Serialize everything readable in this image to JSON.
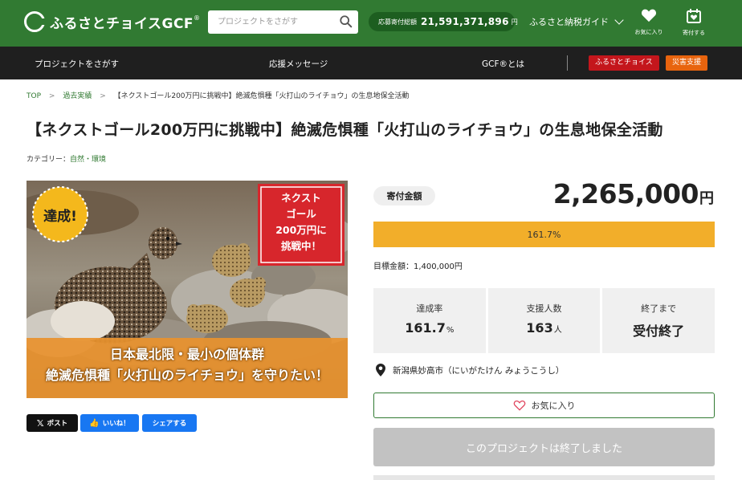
{
  "header": {
    "logo_text": "ふるさとチョイスGCF",
    "logo_reg": "®",
    "search_placeholder": "プロジェクトをさがす",
    "total_label": "応募寄付総額",
    "total_value": "21,591,371,896",
    "total_unit": "円",
    "guide_label": "ふるさと納税ガイド",
    "favorites_label": "お気に入り",
    "donate_label": "寄付する"
  },
  "nav": {
    "find": "プロジェクトをさがす",
    "messages": "応援メッセージ",
    "about": "GCF®とは",
    "choice_badge": "ふるさとチョイス",
    "disaster_badge": "災害支援",
    "choice_color": "#c4161c",
    "disaster_color": "#e8640e"
  },
  "breadcrumb": {
    "top": "TOP",
    "past": "過去実績",
    "current": "【ネクストゴール200万円に挑戦中】絶滅危惧種「火打山のライチョウ」の生息地保全活動"
  },
  "project": {
    "title": "【ネクストゴール200万円に挑戦中】絶滅危惧種「火打山のライチョウ」の生息地保全活動",
    "category_label": "カテゴリー：",
    "category_value": "自然・環境"
  },
  "hero": {
    "badge": "達成!",
    "goal_line1": "ネクスト",
    "goal_line2": "ゴール",
    "goal_line3": "200万円に",
    "goal_line4": "挑戦中！",
    "caption_line1": "日本最北限・最小の個体群",
    "caption_line2": "絶滅危惧種「火打山のライチョウ」を守りたい！"
  },
  "share": {
    "post": "ポスト",
    "like": "いいね！",
    "share": "シェアする"
  },
  "funding": {
    "amount_label": "寄付金額",
    "amount": "2,265,000",
    "amount_unit": "円",
    "progress_text": "161.7%",
    "progress_fraction": 1.0,
    "target": "目標金額：1,400,000円",
    "stats": {
      "rate_label": "達成率",
      "rate_value": "161.7",
      "rate_unit": "%",
      "supporters_label": "支援人数",
      "supporters_value": "163",
      "supporters_unit": "人",
      "end_label": "終了まで",
      "end_value": "受付終了"
    },
    "location": "新潟県妙高市（にいがたけん みょうこうし）",
    "favorite_button": "お気に入り",
    "ended_button": "このプロジェクトは終了しました"
  },
  "colors": {
    "brand_green": "#317a32",
    "progress": "#f2ae2a"
  }
}
